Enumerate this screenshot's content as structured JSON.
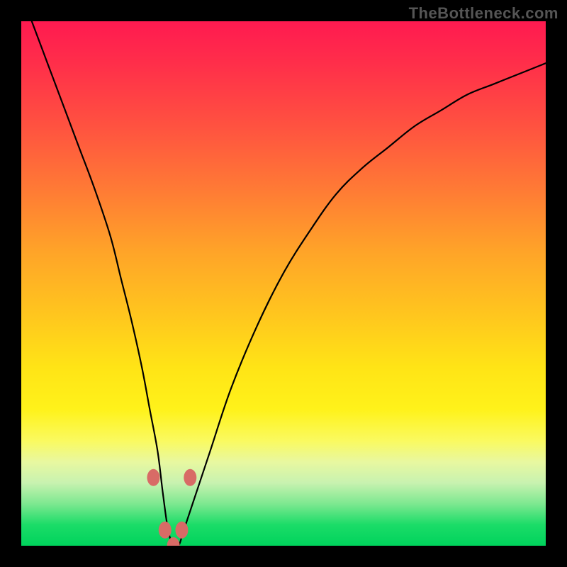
{
  "watermark": "TheBottleneck.com",
  "colors": {
    "frame_bg": "#000000",
    "gradient_top": "#ff1a50",
    "gradient_mid": "#ffe416",
    "gradient_bottom": "#00d35c",
    "curve_stroke": "#000000",
    "marker_fill": "#d86b66"
  },
  "chart_data": {
    "type": "line",
    "title": "",
    "xlabel": "",
    "ylabel": "",
    "xlim": [
      0,
      100
    ],
    "ylim": [
      0,
      100
    ],
    "grid": false,
    "legend": false,
    "series": [
      {
        "name": "curve",
        "x": [
          2,
          5,
          8,
          11,
          14,
          17,
          19,
          21,
          23,
          24.5,
          26,
          27,
          28,
          29,
          30,
          31,
          33,
          36,
          40,
          45,
          50,
          55,
          60,
          65,
          70,
          75,
          80,
          85,
          90,
          95,
          100
        ],
        "values": [
          100,
          92,
          84,
          76,
          68,
          59,
          51,
          43,
          34,
          26,
          18,
          10,
          3,
          0,
          0,
          3,
          9,
          18,
          30,
          42,
          52,
          60,
          67,
          72,
          76,
          80,
          83,
          86,
          88,
          90,
          92
        ]
      }
    ],
    "markers": [
      {
        "x": 25.2,
        "y": 13
      },
      {
        "x": 32.2,
        "y": 13
      },
      {
        "x": 27.4,
        "y": 3
      },
      {
        "x": 30.6,
        "y": 3
      },
      {
        "x": 29.0,
        "y": 0
      }
    ],
    "notes": "y=0 at bottom (green), y=100 at top (red). Curve approaches but does not touch top edge on left; minimum (~0) near x≈29; rises smoothly toward upper-right but flattens, reaching ~92 at x=100."
  }
}
